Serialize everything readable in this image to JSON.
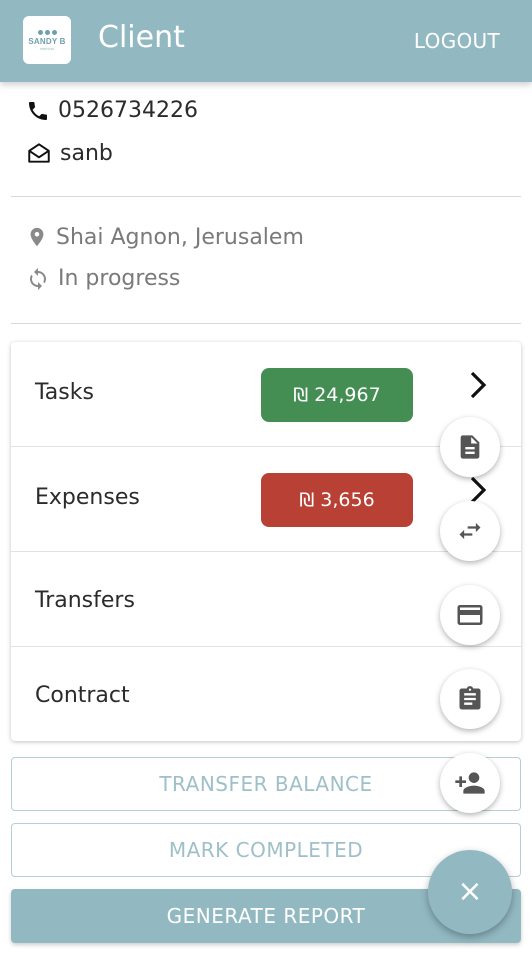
{
  "app": {
    "logo_text": "SANDY B",
    "logo_subtext": "interiors",
    "title": "Client",
    "logout_label": "LOGOUT",
    "accent_color": "#92b9c2"
  },
  "client": {
    "phone": "0526734226",
    "email": "sanb",
    "address": "Shai Agnon, Jerusalem",
    "status": "In progress"
  },
  "sections": [
    {
      "label": "Tasks",
      "amount": "₪ 24,967",
      "amount_color": "#458e53"
    },
    {
      "label": "Expenses",
      "amount": "₪ 3,656",
      "amount_color": "#b84034"
    },
    {
      "label": "Transfers"
    },
    {
      "label": "Contract"
    }
  ],
  "fab_actions": [
    {
      "icon": "document-icon"
    },
    {
      "icon": "swap-icon"
    },
    {
      "icon": "credit-card-icon"
    },
    {
      "icon": "clipboard-icon"
    },
    {
      "icon": "add-person-icon"
    }
  ],
  "fab_main": {
    "icon": "close-icon",
    "label": "×"
  },
  "buttons": {
    "transfer_balance": "TRANSFER BALANCE",
    "mark_completed": "MARK COMPLETED",
    "generate_report": "GENERATE REPORT"
  }
}
